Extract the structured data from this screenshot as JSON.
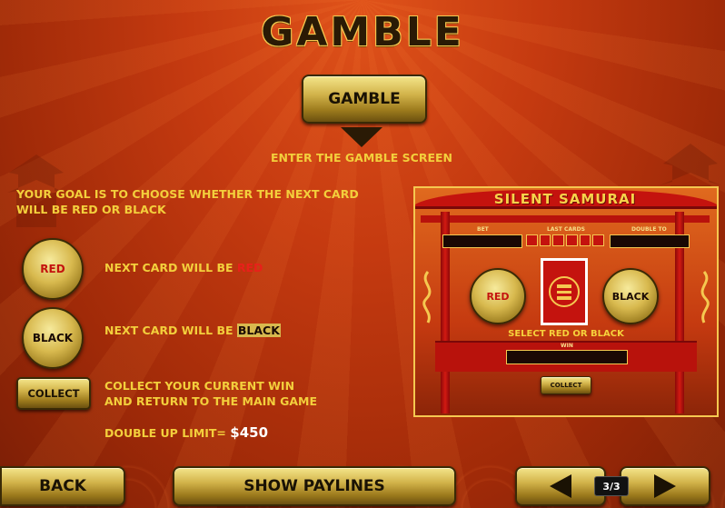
{
  "title": "GAMBLE",
  "gamble_button": {
    "label": "GAMBLE"
  },
  "gamble_caption": "ENTER THE GAMBLE SCREEN",
  "goal_text_line1": "YOUR GOAL IS TO CHOOSE WHETHER THE NEXT CARD",
  "goal_text_line2": "WILL BE RED OR BLACK",
  "options": {
    "red": {
      "button": "RED",
      "desc": "NEXT CARD WILL BE",
      "word": "RED"
    },
    "black": {
      "button": "BLACK",
      "desc": "NEXT CARD WILL BE",
      "word": "BLACK"
    },
    "collect": {
      "button": "COLLECT",
      "desc_line1": "COLLECT YOUR CURRENT WIN",
      "desc_line2": "AND RETURN TO THE MAIN GAME"
    }
  },
  "limit": {
    "label": "DOUBLE UP LIMIT=",
    "value": "$450"
  },
  "preview": {
    "logo": "SILENT SAMURAI",
    "bet_label": "BET",
    "last_cards_label": "LAST CARDS",
    "double_to_label": "DOUBLE TO",
    "red_button": "RED",
    "black_button": "BLACK",
    "select_text": "SELECT RED OR BLACK",
    "win_label": "WIN",
    "collect_button": "COLLECT"
  },
  "footer": {
    "back": "BACK",
    "show_paylines": "SHOW PAYLINES",
    "page_indicator": "3/3"
  },
  "colors": {
    "accent_gold": "#f6d23c",
    "red_text": "#e8201a"
  }
}
